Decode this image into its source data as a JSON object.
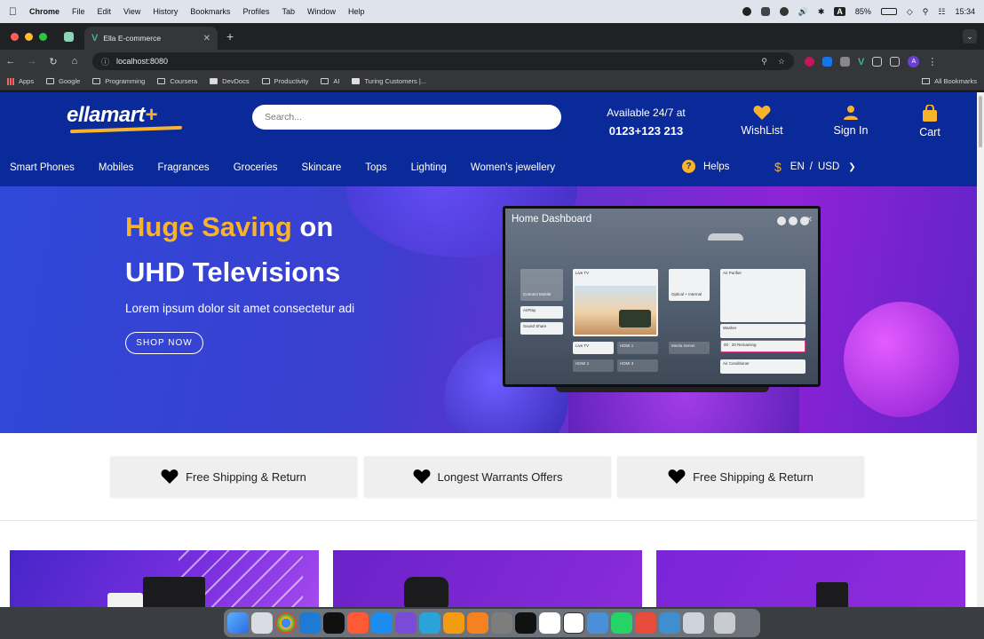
{
  "menubar": {
    "app": "Chrome",
    "items": [
      "File",
      "Edit",
      "View",
      "History",
      "Bookmarks",
      "Profiles",
      "Tab",
      "Window",
      "Help"
    ],
    "battery": "85%",
    "clock": "15:34"
  },
  "browser": {
    "tab_title": "Ella E-commerce",
    "url": "localhost:8080",
    "bookmarks": [
      "Apps",
      "Google",
      "Programming",
      "Coursera",
      "DevDocs",
      "Productivity",
      "AI",
      "Turing Customers |..."
    ],
    "all_bookmarks": "All Bookmarks"
  },
  "site": {
    "logo_text": "ellamart",
    "logo_plus": "+",
    "search_placeholder": "Search...",
    "availability": "Available 24/7 at",
    "phone": "0123+123 213",
    "wishlist": "WishList",
    "signin": "Sign In",
    "cart": "Cart",
    "categories": [
      "Smart Phones",
      "Mobiles",
      "Fragrances",
      "Groceries",
      "Skincare",
      "Tops",
      "Lighting",
      "Women's jewellery"
    ],
    "helps": "Helps",
    "language": "EN",
    "currency": "USD",
    "colors": {
      "primary": "#0b2a9a",
      "accent": "#f7b32b"
    }
  },
  "hero": {
    "title_accent": "Huge Saving",
    "title_rest": "on",
    "title_line2": "UHD Televisions",
    "subtitle": "Lorem ipsum dolor sit amet consectetur adi",
    "cta": "SHOP NOW",
    "tv": {
      "screen_title": "Home Dashboard",
      "cards": [
        "Connect Mobile",
        "AirPlay",
        "Sound Share",
        "Live TV",
        "Optical + Internal",
        "Air Purifier",
        "Washer",
        "00 : 20 Remaining",
        "Air Conditioner",
        "Live TV",
        "HDMI 1",
        "HDMI 2",
        "HDMI 3",
        "Media Server"
      ]
    }
  },
  "features": [
    "Free Shipping & Return",
    "Longest Warrants Offers",
    "Free Shipping & Return"
  ]
}
